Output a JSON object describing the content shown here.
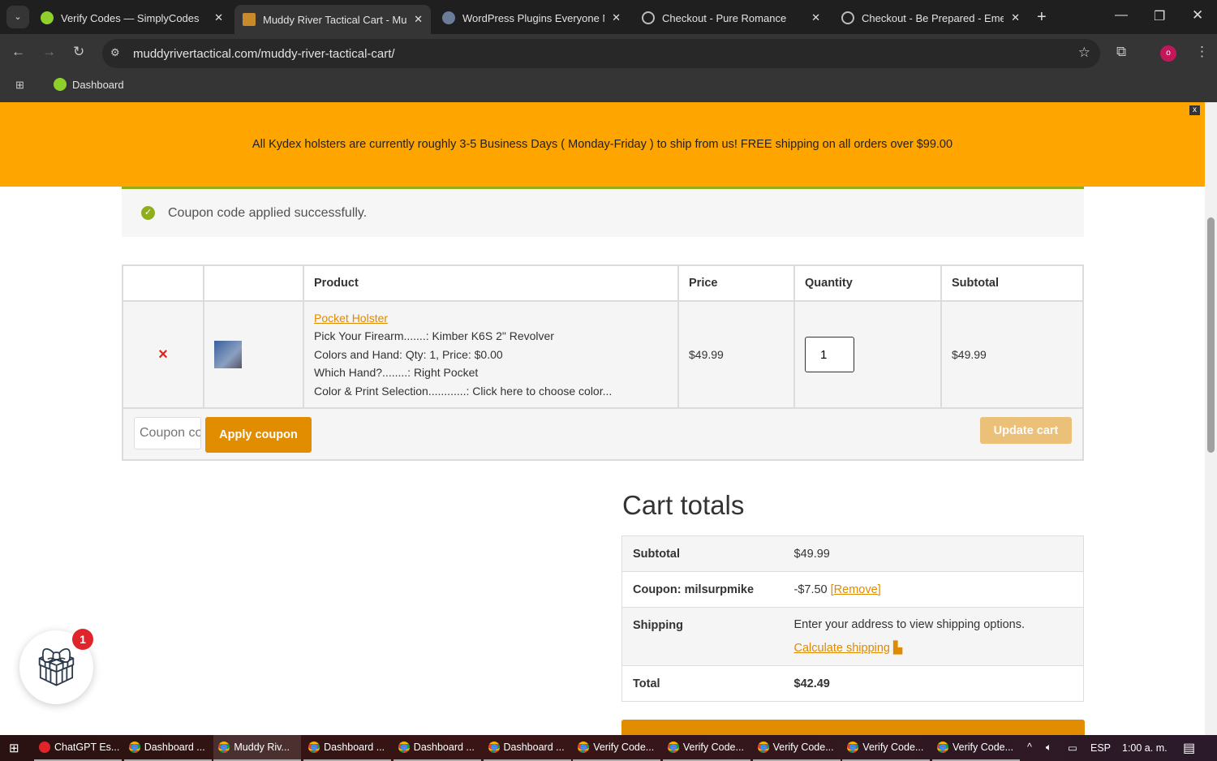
{
  "browser": {
    "tabs": [
      {
        "title": "Verify Codes — SimplyCodes"
      },
      {
        "title": "Muddy River Tactical Cart - Mu",
        "active": true
      },
      {
        "title": "WordPress Plugins Everyone Ne"
      },
      {
        "title": "Checkout - Pure Romance"
      },
      {
        "title": "Checkout - Be Prepared - Emer"
      }
    ],
    "url": "muddyrivertactical.com/muddy-river-tactical-cart/",
    "bookmark": "Dashboard",
    "profile": "o"
  },
  "banner": {
    "text": "All Kydex holsters are currently roughly 3-5 Business Days ( Monday-Friday ) to ship from us! FREE shipping on all orders over $99.00",
    "close": "x"
  },
  "notice": "Coupon code applied successfully.",
  "cart": {
    "headers": [
      "Product",
      "Price",
      "Quantity",
      "Subtotal"
    ],
    "item": {
      "name": "Pocket Holster",
      "meta": [
        "Pick Your Firearm.......: Kimber K6S 2\" Revolver",
        "Colors and Hand: Qty: 1, Price: $0.00",
        "Which Hand?........: Right Pocket",
        "Color & Print Selection............: Click here to choose color..."
      ],
      "price": "$49.99",
      "quantity": "1",
      "subtotal": "$49.99"
    },
    "coupon_placeholder": "Coupon code",
    "apply": "Apply coupon",
    "update": "Update cart"
  },
  "totals": {
    "title": "Cart totals",
    "subtotal_label": "Subtotal",
    "subtotal": "$49.99",
    "coupon_label": "Coupon: milsurpmike",
    "coupon_value": "-$7.50",
    "remove": "[Remove]",
    "shipping_label": "Shipping",
    "shipping_text": "Enter your address to view shipping options.",
    "calc": "Calculate shipping",
    "total_label": "Total",
    "total": "$42.49"
  },
  "gift": {
    "badge": "1"
  },
  "taskbar": {
    "items": [
      "ChatGPT Es...",
      "Dashboard ...",
      "Muddy Riv...",
      "Dashboard ...",
      "Dashboard ...",
      "Dashboard ...",
      "Verify Code...",
      "Verify Code...",
      "Verify Code...",
      "Verify Code...",
      "Verify Code..."
    ],
    "lang": "ESP",
    "time": "1:00 a. m."
  },
  "colors": {
    "accent": "#e28d00",
    "banner": "#ffa500"
  }
}
